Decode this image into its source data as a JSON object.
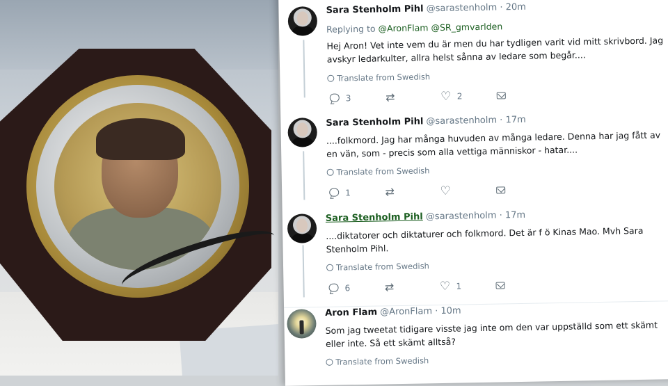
{
  "tweets": [
    {
      "name": "Sara Stenholm Pihl",
      "handle": "@sarastenholm",
      "time": "· 20m",
      "replying_label": "Replying to",
      "replying_to": [
        "@AronFlam",
        "@SR_gmvarlden"
      ],
      "text": "Hej Aron! Vet inte vem du är men du har tydligen varit vid mitt skrivbord. Jag avskyr ledarkulter, allra helst sånna av ledare som begår....",
      "translate": "Translate from Swedish",
      "replies": "3",
      "retweets": "",
      "likes": "2"
    },
    {
      "name": "Sara Stenholm Pihl",
      "handle": "@sarastenholm",
      "time": "· 17m",
      "text": "....folkmord. Jag har många huvuden av många ledare. Denna har jag fått av en vän, som - precis som alla vettiga människor - hatar....",
      "translate": "Translate from Swedish",
      "replies": "1",
      "retweets": "",
      "likes": ""
    },
    {
      "name": "Sara Stenholm Pihl",
      "handle": "@sarastenholm",
      "time": "· 17m",
      "text": "....diktatorer och diktaturer och folkmord. Det är f ö Kinas Mao. Mvh Sara Stenholm Pihl.",
      "translate": "Translate from Swedish",
      "replies": "6",
      "retweets": "",
      "likes": "1"
    },
    {
      "name": "Aron Flam",
      "handle": "@AronFlam",
      "time": "· 10m",
      "text": "Som jag tweetat tidigare visste jag inte om den var uppställd som ett skämt eller inte. Så ett skämt alltså?",
      "translate": "Translate from Swedish"
    }
  ],
  "icons": {
    "reply": "reply-icon",
    "retweet": "retweet-icon",
    "like": "heart-icon",
    "dm": "envelope-icon",
    "translate": "globe-icon",
    "menu": "chevron-down-icon"
  },
  "colors": {
    "name": "#14171a",
    "muted": "#657786",
    "mention": "#1b5e20",
    "thread_line": "#c4cfd6"
  }
}
